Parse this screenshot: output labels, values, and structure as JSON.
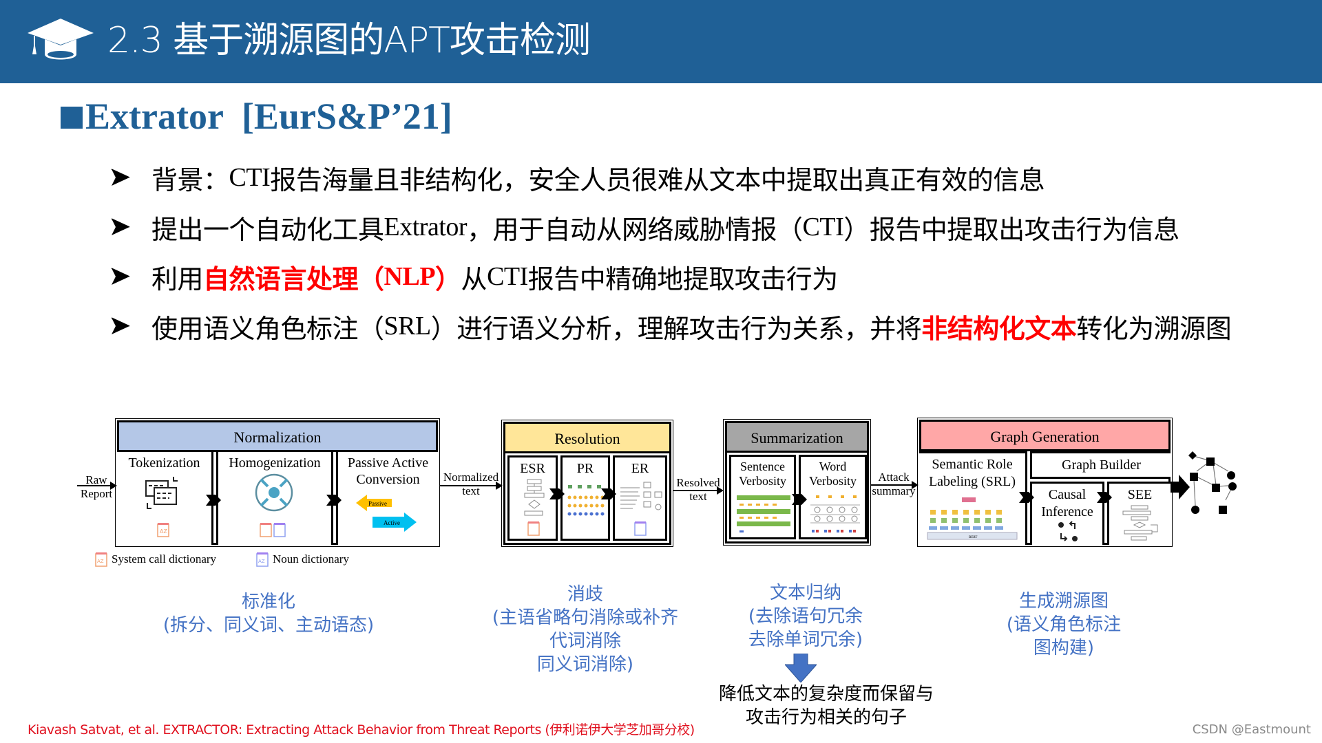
{
  "header": {
    "icon": "graduation-cap-icon",
    "title": "2.3 基于溯源图的APT攻击检测",
    "background_color": "#1f6096"
  },
  "section": {
    "marker": "square-bullet-icon",
    "title": "Extrator  [EurS&P’21]",
    "color": "#1f6096"
  },
  "bullets": [
    {
      "marker": "arrow-bullet-icon",
      "parts": [
        {
          "text": "背景："
        },
        {
          "text": "CTI",
          "latin": true
        },
        {
          "text": "报告海量且非结构化，安全人员很难从文本中提取出真正有效的信息"
        }
      ]
    },
    {
      "marker": "arrow-bullet-icon",
      "parts": [
        {
          "text": "提出一个自动化工具"
        },
        {
          "text": "Extrator",
          "latin": true
        },
        {
          "text": "，用于自动从网络威胁情报（"
        },
        {
          "text": "CTI",
          "latin": true
        },
        {
          "text": "）报告中提取出攻击行为信息"
        }
      ]
    },
    {
      "marker": "arrow-bullet-icon",
      "parts": [
        {
          "text": "利用"
        },
        {
          "text": "自然语言处理（",
          "highlight": true
        },
        {
          "text": "NLP",
          "highlight": true,
          "latin": true
        },
        {
          "text": "）",
          "highlight": true
        },
        {
          "text": "从"
        },
        {
          "text": "CTI",
          "latin": true
        },
        {
          "text": "报告中精确地提取攻击行为"
        }
      ]
    },
    {
      "marker": "arrow-bullet-icon",
      "parts": [
        {
          "text": "使用语义角色标注（"
        },
        {
          "text": "SRL",
          "latin": true
        },
        {
          "text": "）进行语义分析，理解攻击行为关系，并将"
        },
        {
          "text": "非结构化文本",
          "highlight": true
        },
        {
          "text": "转化为溯源图"
        }
      ]
    }
  ],
  "highlight_color": "#ff0000",
  "diagram": {
    "input_label": [
      "Raw",
      "Report"
    ],
    "stages": [
      {
        "name": "Normalization",
        "color": "#b4c7e7",
        "substeps": [
          "Tokenization",
          "Homogenization",
          "Passive Active\nConversion"
        ],
        "passive_label": "Passive",
        "active_label": "Active",
        "output_label": [
          "Normalized",
          "text"
        ]
      },
      {
        "name": "Resolution",
        "color": "#ffe699",
        "substeps": [
          "ESR",
          "PR",
          "ER"
        ],
        "output_label": [
          "Resolved",
          "text"
        ]
      },
      {
        "name": "Summarization",
        "color": "#a6a6a6",
        "substeps": [
          "Sentence\nVerbosity",
          "Word\nVerbosity"
        ],
        "output_label": [
          "Attack",
          "summary"
        ]
      },
      {
        "name": "Graph Generation",
        "color": "#ffa7a7",
        "substeps": [
          "Semantic Role\nLabeling (SRL)",
          "Graph Builder",
          "Causal\nInference",
          "SEE"
        ],
        "srl_base_label": "BERT"
      }
    ],
    "legend": [
      {
        "icon": "system-call-dictionary-icon",
        "label": "System call dictionary"
      },
      {
        "icon": "noun-dictionary-icon",
        "label": "Noun dictionary"
      }
    ]
  },
  "captions": [
    {
      "lines": [
        "标准化",
        "(拆分、同义词、主动语态)"
      ]
    },
    {
      "lines": [
        "消歧",
        "(主语省略句消除或补齐",
        "代词消除",
        "同义词消除)"
      ]
    },
    {
      "lines": [
        "文本归纳",
        "(去除语句冗余",
        "去除单词冗余)"
      ]
    },
    {
      "lines": [
        "生成溯源图",
        "(语义角色标注",
        "图构建)"
      ]
    }
  ],
  "caption_color": "#4472c4",
  "summary_note": [
    "降低文本的复杂度而保留与",
    "攻击行为相关的句子"
  ],
  "citation": "Kiavash Satvat, et al. EXTRACTOR: Extracting Attack Behavior from Threat Reports (伊利诺伊大学芝加哥分校)",
  "watermark": "CSDN @Eastmount"
}
